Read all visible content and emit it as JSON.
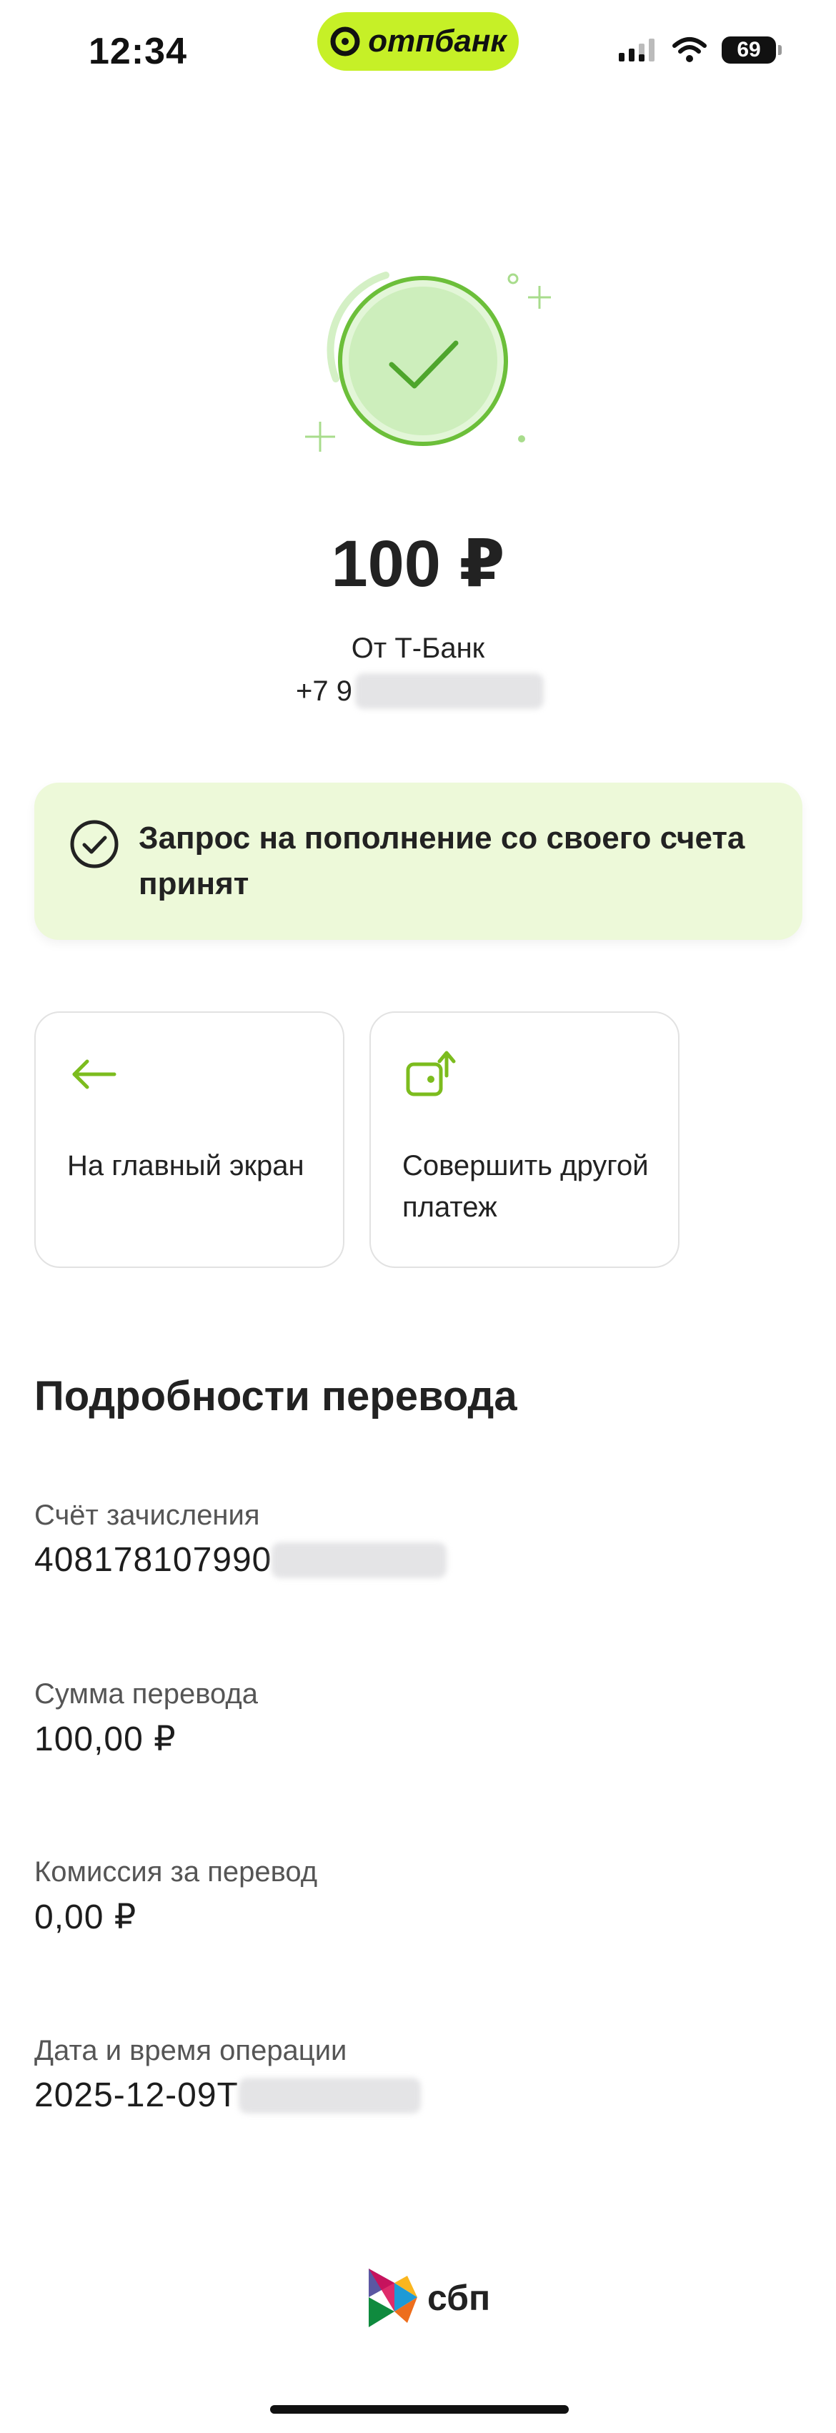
{
  "status_bar": {
    "time": "12:34",
    "bank_badge": "отпбанк",
    "battery": "69",
    "badge_color": "#c6f027"
  },
  "payment": {
    "amount": "100 ₽",
    "from": "От Т-Банк",
    "phone_visible": "+7 9"
  },
  "notice": {
    "text": "Запрос на пополнение со своего счета принят",
    "icon": "check-circle-icon",
    "background": "#edf9d9"
  },
  "actions": [
    {
      "label": "На главный экран",
      "icon": "arrow-left-icon"
    },
    {
      "label": "Совершить другой платеж",
      "icon": "wallet-transfer-icon"
    }
  ],
  "details": {
    "title": "Подробности перевода",
    "items": [
      {
        "label": "Счёт зачисления",
        "value": "408178107990",
        "redacted": true
      },
      {
        "label": "Сумма перевода",
        "value": "100,00 ₽",
        "redacted": false
      },
      {
        "label": "Комиссия за перевод",
        "value": "0,00 ₽",
        "redacted": false
      },
      {
        "label": "Дата и время операции",
        "value": "2025-12-09T",
        "redacted": true
      }
    ]
  },
  "footer": {
    "sbp_label": "сбп"
  },
  "colors": {
    "accent_green": "#6cbf3a",
    "success_circle": "#cdeebc"
  }
}
